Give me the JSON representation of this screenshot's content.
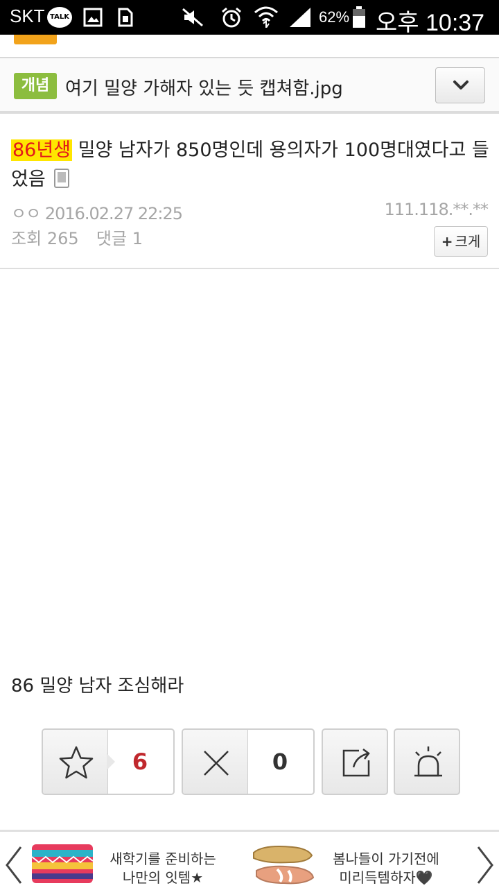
{
  "status_bar": {
    "carrier": "SKT",
    "talk_badge": "TALK",
    "battery_percent": "62%",
    "time": "오후 10:37",
    "icons": [
      "talk-icon",
      "image-icon",
      "sim-icon",
      "mute-icon",
      "alarm-icon",
      "wifi-icon",
      "signal-icon",
      "battery-icon"
    ]
  },
  "category": {
    "badge": "개념",
    "title": "여기 밀양 가해자 있는 듯 캡쳐함.jpg",
    "accent_color": "#8cbd3f"
  },
  "post": {
    "tag": "86년생",
    "title": "밀양 남자가 850명인데 용의자가 100명대였다고 들었음",
    "author": "ㅇㅇ",
    "date": "2016.02.27 22:25",
    "ip": "111.118.**.**",
    "views_label": "조회",
    "views": "265",
    "comments_label": "댓글",
    "comments": "1",
    "zoom_label": "크게",
    "body": "86 밀양 남자 조심해라"
  },
  "actions": {
    "recommend_count": "6",
    "unrecommend_count": "0",
    "recommend_color": "#c0282d"
  },
  "ads": [
    {
      "text_line1": "새학기를 준비하는",
      "text_line2": "나만의 잇템★"
    },
    {
      "text_line1": "봄나들이 가기전에",
      "text_line2": "미리득템하자🖤"
    }
  ]
}
